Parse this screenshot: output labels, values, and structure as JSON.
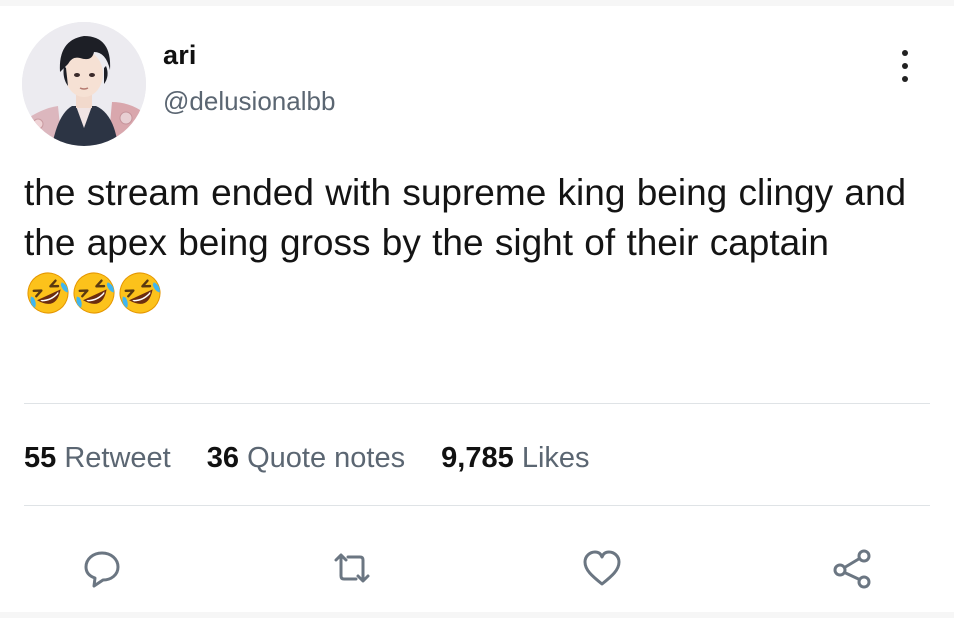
{
  "author": {
    "name": "ari",
    "handle": "@delusionalbb"
  },
  "tweet": {
    "text": "the stream ended with supreme king being clingy and the apex being gross by the sight of their captain",
    "emojis": [
      "rolling-on-floor-laughing-emoji",
      "rolling-on-floor-laughing-emoji",
      "rolling-on-floor-laughing-emoji"
    ]
  },
  "stats": {
    "retweets": {
      "count": "55",
      "label": "Retweet"
    },
    "quotes": {
      "count": "36",
      "label": "Quote notes"
    },
    "likes": {
      "count": "9,785",
      "label": "Likes"
    }
  },
  "actions": [
    "reply-icon",
    "retweet-icon",
    "like-icon",
    "share-icon"
  ],
  "colors": {
    "text": "#141414",
    "secondary_text": "#5b6672",
    "divider": "#dfe3e6",
    "icon": "#6b7682",
    "background": "#ffffff"
  }
}
